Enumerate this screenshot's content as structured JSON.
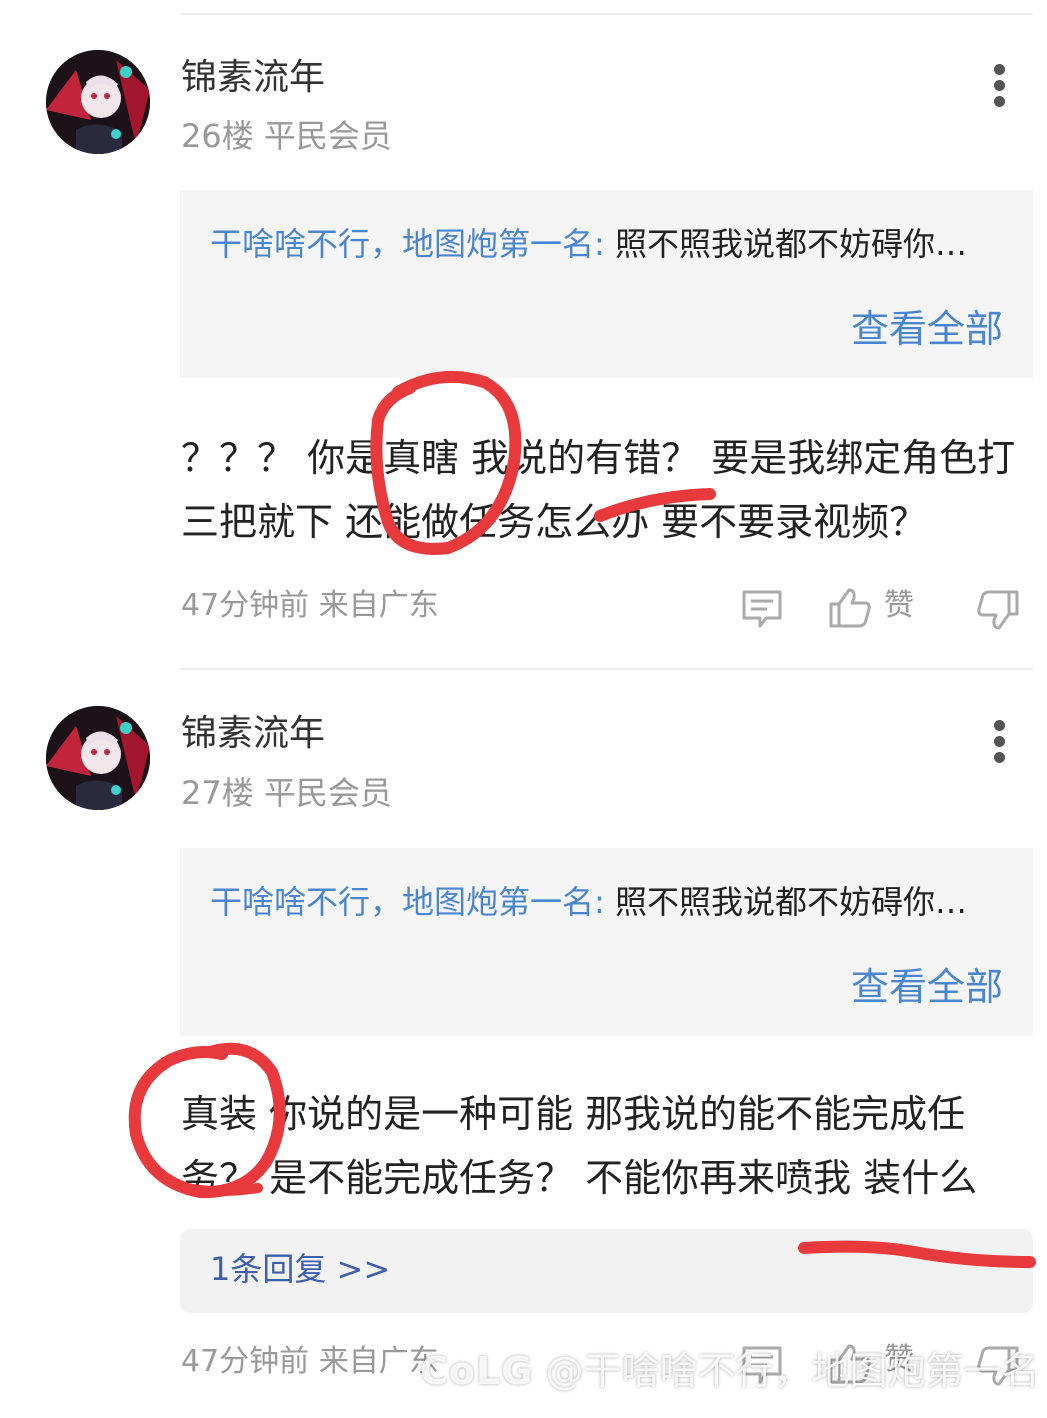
{
  "colors": {
    "accent": "#4a86cf",
    "reply_link": "#3d5fae",
    "annotation": "#e8393d",
    "meta": "#999999"
  },
  "comments": [
    {
      "username": "锦素流年",
      "floor": "26楼",
      "rank": "平民会员",
      "quote": {
        "author": "干啥啥不行，地图炮第一名:",
        "text": " 照不照我说都不妨碍你…",
        "view_all": "查看全部"
      },
      "body": "？？？ 你是真瞎 我说的有错？ 要是我绑定角色打三把就下 还能做任务怎么办 要不要录视频？",
      "time": "47分钟前",
      "location": "来自广东",
      "like_label": "赞",
      "icons": [
        "more-vertical-icon",
        "reply-comment-icon",
        "thumbs-up-icon",
        "thumbs-down-icon"
      ]
    },
    {
      "username": "锦素流年",
      "floor": "27楼",
      "rank": "平民会员",
      "quote": {
        "author": "干啥啥不行，地图炮第一名:",
        "text": " 照不照我说都不妨碍你…",
        "view_all": "查看全部"
      },
      "body": "真装 你说的是一种可能 那我说的能不能完成任务？ 是不能完成任务？ 不能你再来喷我 装什么",
      "replies": "1条回复 >>",
      "time": "47分钟前",
      "location": "来自广东",
      "like_label": "赞",
      "icons": [
        "more-vertical-icon",
        "reply-comment-icon",
        "thumbs-up-icon",
        "thumbs-down-icon"
      ]
    }
  ],
  "watermark": {
    "logo": "CoLG",
    "text": " @干啥啥不行，地图炮第一名"
  }
}
